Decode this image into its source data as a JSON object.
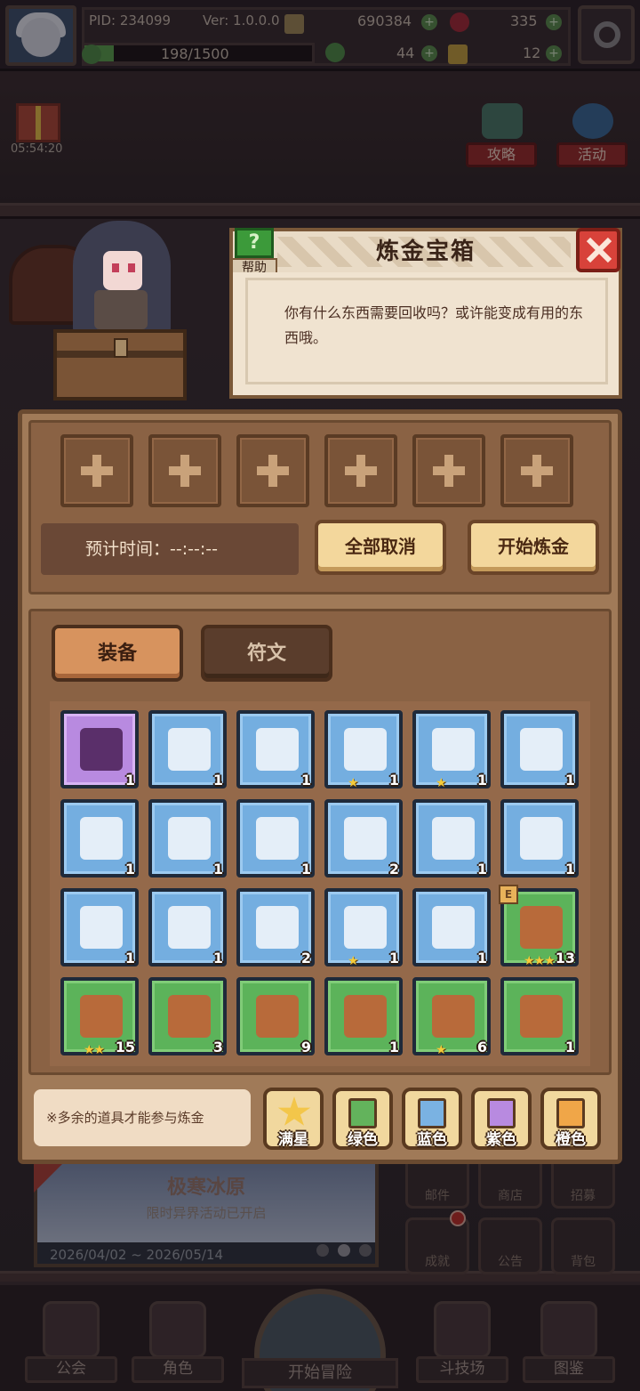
{
  "topbar": {
    "pid": "PID: 234099",
    "version": "Ver: 1.0.0.0",
    "coins": "690384",
    "gems": "335",
    "exp": "198/1500",
    "clover": "44",
    "keys": "12"
  },
  "side": {
    "timer": "05:54:20",
    "guide_label": "攻略",
    "event_label": "活动"
  },
  "dialog": {
    "title": "炼金宝箱",
    "help_label": "帮助",
    "message": "你有什么东西需要回收吗？或许能变成有用的东西哦。"
  },
  "alchemy": {
    "eta_label": "预计时间：--:--:--",
    "cancel_all": "全部取消",
    "start": "开始炼金"
  },
  "tabs": [
    "装备",
    "符文"
  ],
  "items": [
    {
      "rarity": "purple",
      "icon": "boot-icon",
      "count": "1",
      "stars": ""
    },
    {
      "rarity": "blue",
      "icon": "staff-icon",
      "count": "1",
      "stars": ""
    },
    {
      "rarity": "blue",
      "icon": "sword-icon",
      "count": "1",
      "stars": ""
    },
    {
      "rarity": "blue",
      "icon": "orb-icon",
      "count": "1",
      "stars": "★"
    },
    {
      "rarity": "blue",
      "icon": "dagger-icon",
      "count": "1",
      "stars": "★"
    },
    {
      "rarity": "blue",
      "icon": "wizard-hat-icon",
      "count": "1",
      "stars": ""
    },
    {
      "rarity": "blue",
      "icon": "dark-armor-icon",
      "count": "1",
      "stars": ""
    },
    {
      "rarity": "blue",
      "icon": "vest-icon",
      "count": "1",
      "stars": ""
    },
    {
      "rarity": "blue",
      "icon": "silver-armor-icon",
      "count": "1",
      "stars": ""
    },
    {
      "rarity": "blue",
      "icon": "collar-icon",
      "count": "2",
      "stars": ""
    },
    {
      "rarity": "blue",
      "icon": "purple-boots-icon",
      "count": "1",
      "stars": ""
    },
    {
      "rarity": "blue",
      "icon": "white-boots-icon",
      "count": "1",
      "stars": ""
    },
    {
      "rarity": "blue",
      "icon": "steel-boots-icon",
      "count": "1",
      "stars": ""
    },
    {
      "rarity": "blue",
      "icon": "gem-ring-icon",
      "count": "1",
      "stars": ""
    },
    {
      "rarity": "blue",
      "icon": "heart-amulet-icon",
      "count": "2",
      "stars": ""
    },
    {
      "rarity": "blue",
      "icon": "helmet-icon",
      "count": "1",
      "stars": "★"
    },
    {
      "rarity": "blue",
      "icon": "ruby-ring-icon",
      "count": "1",
      "stars": ""
    },
    {
      "rarity": "green",
      "icon": "wooden-shield-icon",
      "count": "13",
      "stars": "★★★",
      "tag": "E"
    },
    {
      "rarity": "green",
      "icon": "wooden-sword-icon",
      "count": "15",
      "stars": "★★"
    },
    {
      "rarity": "green",
      "icon": "bow-icon",
      "count": "3",
      "stars": ""
    },
    {
      "rarity": "green",
      "icon": "short-sword-icon",
      "count": "9",
      "stars": ""
    },
    {
      "rarity": "green",
      "icon": "knife-icon",
      "count": "1",
      "stars": ""
    },
    {
      "rarity": "green",
      "icon": "round-shield-icon",
      "count": "6",
      "stars": "★"
    },
    {
      "rarity": "green",
      "icon": "stone-icon",
      "count": "1",
      "stars": ""
    }
  ],
  "footer": {
    "note": "※多余的道具才能参与炼金",
    "filters": [
      {
        "label": "满星",
        "color": "#f3c64a"
      },
      {
        "label": "绿色",
        "color": "#63b35c"
      },
      {
        "label": "蓝色",
        "color": "#7ab2e2"
      },
      {
        "label": "紫色",
        "color": "#b88ae0"
      },
      {
        "label": "橙色",
        "color": "#f0a648"
      }
    ]
  },
  "background": {
    "event_title": "极寒冰原",
    "event_subtitle": "限时异界活动已开启",
    "event_dates": "2026/04/02 ~ 2026/05/14",
    "mail": "邮件",
    "shop": "商店",
    "recruit": "招募",
    "achievement": "成就",
    "notice": "公告",
    "bag": "背包",
    "nav": [
      "公会",
      "角色",
      "开始冒险",
      "斗技场",
      "图鉴"
    ]
  },
  "colors": {
    "panel": "#a07a58",
    "accent_gold": "#f3d79c",
    "close_red": "#d8423a",
    "help_green": "#3c9a3a"
  }
}
